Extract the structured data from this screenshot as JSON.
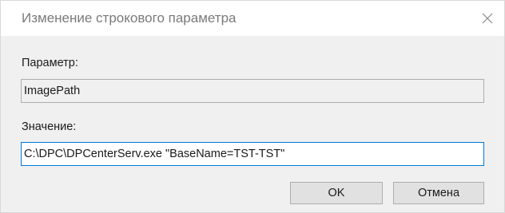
{
  "window": {
    "title": "Изменение строкового параметра",
    "close_icon": "close-icon"
  },
  "form": {
    "param_label": "Параметр:",
    "param_value": "ImagePath",
    "value_label": "Значение:",
    "value_text": "C:\\DPC\\DPCenterServ.exe \"BaseName=TST-TST\""
  },
  "buttons": {
    "ok_label": "OK",
    "cancel_label": "Отмена"
  },
  "colors": {
    "dialog_bg": "#f0f0f0",
    "titlebar_bg": "#ffffff",
    "focus_border": "#0078d7",
    "button_bg": "#e1e1e1"
  }
}
